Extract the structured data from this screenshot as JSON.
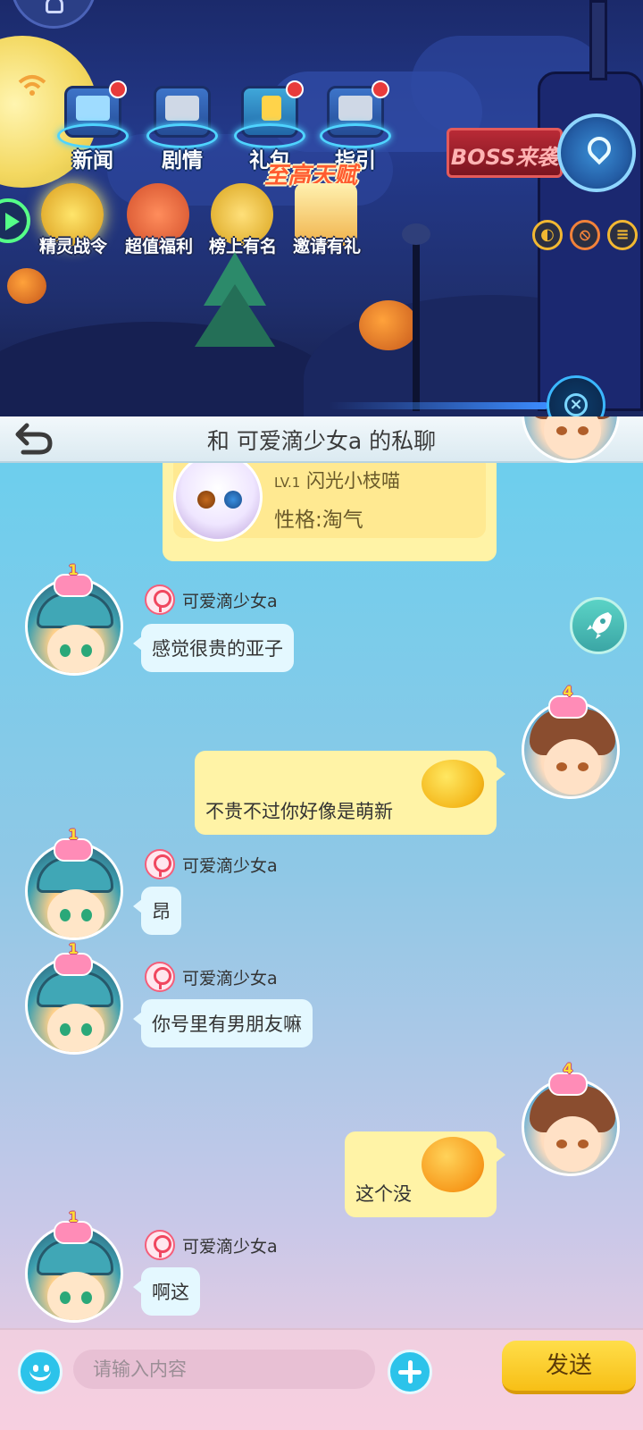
{
  "game": {
    "top_buttons": [
      {
        "label": "新闻",
        "badge": true
      },
      {
        "label": "剧情",
        "badge": false
      },
      {
        "label": "礼包",
        "badge": true
      },
      {
        "label": "指引",
        "badge": true
      }
    ],
    "boss_label": "BOSS来袭",
    "banner_label": "至高天赋",
    "events": [
      {
        "label": "精灵战令"
      },
      {
        "label": "超值福利"
      },
      {
        "label": "榜上有名"
      },
      {
        "label": "邀请有礼"
      }
    ]
  },
  "chat": {
    "title": "和 可爱滴少女a 的私聊",
    "pet_card": {
      "level_tag": "LV.1",
      "name": "闪光小枝喵",
      "trait": "性格:淘气"
    },
    "messages": [
      {
        "side": "in",
        "sender": "可爱滴少女a",
        "level": "1",
        "text": "感觉很贵的亚子"
      },
      {
        "side": "out",
        "level": "4",
        "text": "不贵不过你好像是萌新",
        "emoji": "awkward-emoji"
      },
      {
        "side": "in",
        "sender": "可爱滴少女a",
        "level": "1",
        "text": "昂"
      },
      {
        "side": "in",
        "sender": "可爱滴少女a",
        "level": "1",
        "text": "你号里有男朋友嘛"
      },
      {
        "side": "out",
        "level": "4",
        "text": "这个没",
        "emoji": "dizzy-emoji"
      },
      {
        "side": "in",
        "sender": "可爱滴少女a",
        "level": "1",
        "text": "啊这"
      }
    ],
    "input": {
      "placeholder": "请输入内容",
      "value": "",
      "send_label": "发送"
    }
  },
  "colors": {
    "panel_top": "#69cfee",
    "panel_bottom": "#f3cde0",
    "incoming_bubble": "#e4f8ff",
    "outgoing_bubble": "#fff3a6",
    "send_button": "#f7bf16",
    "accent_blue": "#2cc3ea"
  }
}
